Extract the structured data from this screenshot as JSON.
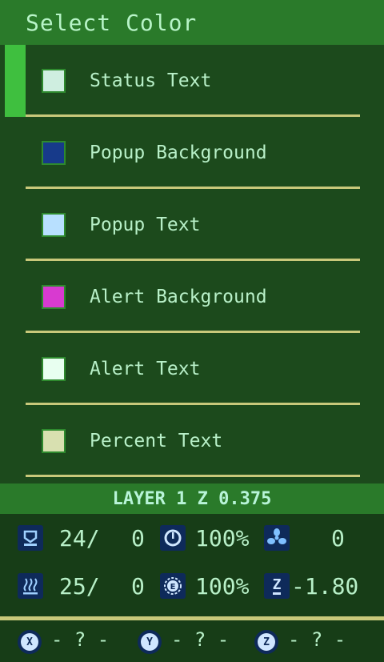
{
  "title": "Select Color",
  "items": [
    {
      "label": "Status Text",
      "swatch": "#cfeee0",
      "selected": true
    },
    {
      "label": "Popup Background",
      "swatch": "#173a8a",
      "selected": false
    },
    {
      "label": "Popup Text",
      "swatch": "#b8e0ff",
      "selected": false
    },
    {
      "label": "Alert Background",
      "swatch": "#d83ad0",
      "selected": false
    },
    {
      "label": "Alert Text",
      "swatch": "#e8fff0",
      "selected": false
    },
    {
      "label": "Percent Text",
      "swatch": "#d8e0b0",
      "selected": false
    }
  ],
  "layer": "LAYER 1 Z 0.375",
  "status": {
    "bed_temp": "24/",
    "bed_target": "0",
    "speed": "100%",
    "fan": "0",
    "hotend_temp": "25/",
    "hotend_target": "0",
    "flow": "100%",
    "z_offset": "-1.80",
    "z_icon": "Z"
  },
  "axes": {
    "x_label": "X",
    "x_value": "- ? -",
    "y_label": "Y",
    "y_value": "- ? -",
    "z_label": "Z",
    "z_value": "- ? -"
  },
  "icons": {
    "bed": "bed-icon",
    "speed": "speed-icon",
    "fan": "fan-icon",
    "hotend": "hotend-icon",
    "flow": "flow-icon",
    "zoffset": "z-offset-icon"
  }
}
